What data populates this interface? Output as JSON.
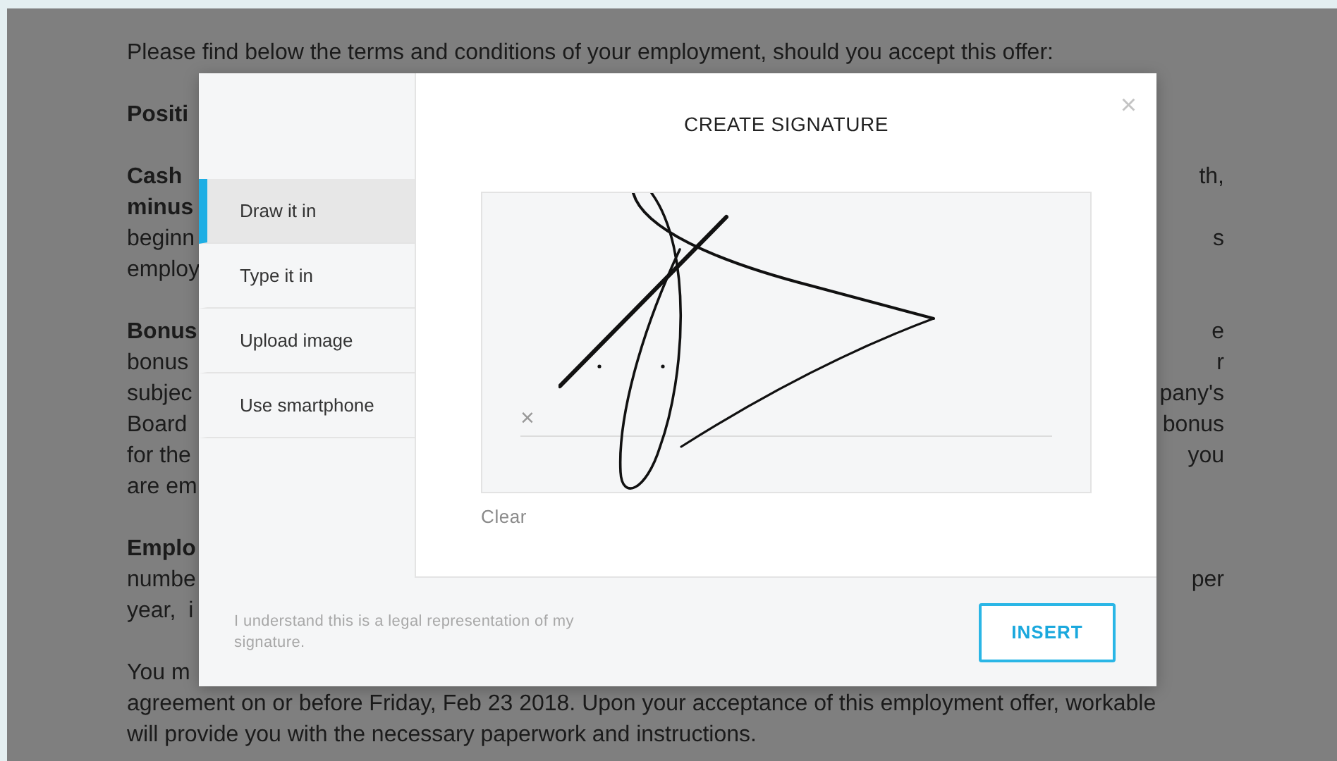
{
  "document": {
    "paragraphs": [
      {
        "lines": [
          {
            "left": "Please find below the terms and conditions of your employment, should you accept this offer:",
            "bold": false
          }
        ]
      },
      {
        "lines": [
          {
            "left": "Positi",
            "bold": true
          }
        ]
      },
      {
        "lines": [
          {
            "left": "Cash",
            "bold": true,
            "right": "th,"
          },
          {
            "left": "minus",
            "bold": true
          },
          {
            "left": "beginn",
            "bold": false,
            "right": "s"
          },
          {
            "left": "employ",
            "bold": false
          }
        ]
      },
      {
        "lines": [
          {
            "left": "Bonus",
            "bold": true,
            "right": "e"
          },
          {
            "left": "bonus",
            "bold": false,
            "right": "r"
          },
          {
            "left": "subjec",
            "bold": false,
            "right": "pany's"
          },
          {
            "left": "Board",
            "bold": false,
            "right": "bonus"
          },
          {
            "left": "for the",
            "bold": false,
            "right": "you"
          },
          {
            "left": "are em",
            "bold": false
          }
        ]
      },
      {
        "lines": [
          {
            "left": "Emplo",
            "bold": true
          },
          {
            "left": "numbe",
            "bold": false,
            "right": "per"
          },
          {
            "left": "year,  i",
            "bold": false
          }
        ]
      },
      {
        "lines": [
          {
            "left": "You m",
            "bold": false
          },
          {
            "left": "agreement on or before Friday, Feb 23 2018. Upon your acceptance of this employment offer, workable",
            "bold": false
          },
          {
            "left": "will provide you with the necessary paperwork and instructions.",
            "bold": false
          }
        ]
      }
    ]
  },
  "dialog": {
    "title": "CREATE SIGNATURE",
    "close": "×",
    "methods": [
      {
        "label": "Draw it in",
        "selected": true
      },
      {
        "label": "Type it in",
        "selected": false
      },
      {
        "label": "Upload image",
        "selected": false
      },
      {
        "label": "Use smartphone",
        "selected": false
      }
    ],
    "canvas": {
      "sign_mark": "×"
    },
    "clear": "Clear",
    "disclaimer": "I understand this is a legal representation of my signature.",
    "insert": "INSERT"
  }
}
